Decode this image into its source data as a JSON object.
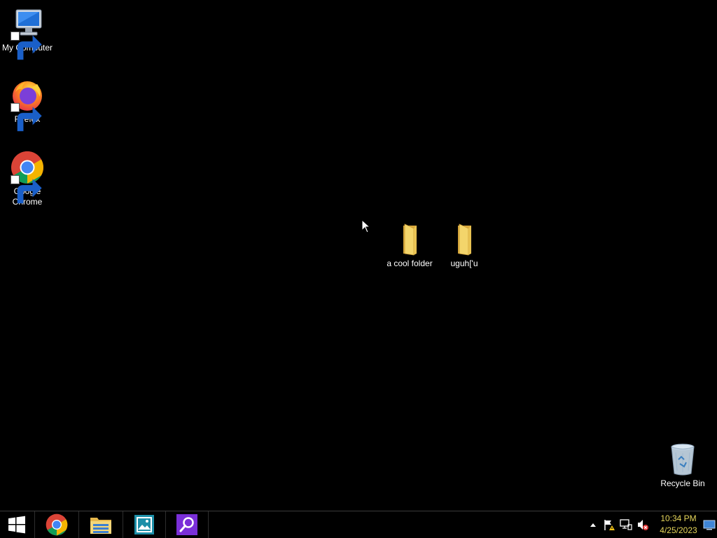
{
  "desktop": {
    "icons": [
      {
        "id": "my-computer",
        "label": "My Computer"
      },
      {
        "id": "firefox",
        "label": "Firefox"
      },
      {
        "id": "chrome",
        "label": "Google Chrome"
      },
      {
        "id": "folder-cool",
        "label": "a cool folder"
      },
      {
        "id": "folder-uguh",
        "label": "uguh['u"
      },
      {
        "id": "recycle-bin",
        "label": "Recycle Bin"
      }
    ]
  },
  "taskbar": {
    "pinned": [
      "start-icon",
      "chrome-icon",
      "file-explorer-icon",
      "photos-icon",
      "search-app-icon"
    ],
    "tray": [
      "show-hidden-icons-arrow",
      "action-center-flag-icon",
      "network-icon",
      "volume-muted-icon"
    ],
    "clock": {
      "time": "10:34 PM",
      "date": "4/25/2023"
    }
  },
  "colors": {
    "desktop_background": "#000000",
    "clock_text": "#e6d65a",
    "folder_yellow": "#f3d56b"
  }
}
